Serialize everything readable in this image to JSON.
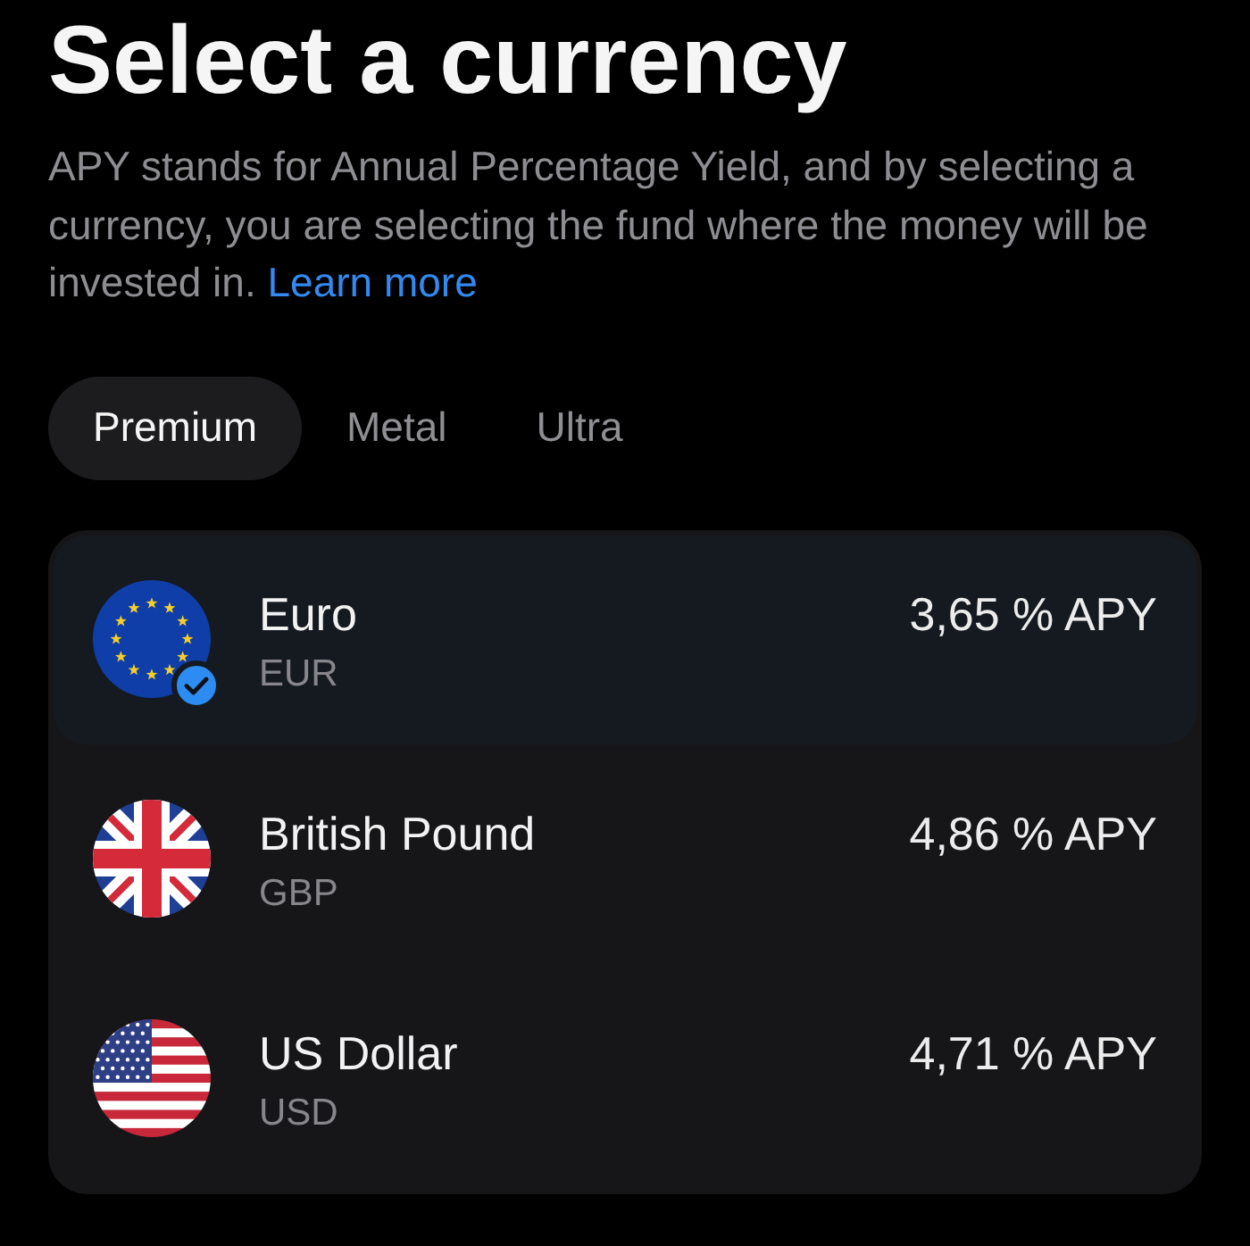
{
  "title": "Select a currency",
  "description": {
    "text": "APY stands for Annual Percentage Yield, and by selecting a currency, you are selecting the fund where the money will be invested in.",
    "link": "Learn more"
  },
  "tabs": [
    {
      "label": "Premium",
      "selected": true
    },
    {
      "label": "Metal",
      "selected": false
    },
    {
      "label": "Ultra",
      "selected": false
    }
  ],
  "currencies": [
    {
      "kind": "eu",
      "name": "Euro",
      "code": "EUR",
      "apy": "3,65 % APY",
      "selected": true
    },
    {
      "kind": "gb",
      "name": "British Pound",
      "code": "GBP",
      "apy": "4,86 % APY",
      "selected": false
    },
    {
      "kind": "us",
      "name": "US Dollar",
      "code": "USD",
      "apy": "4,71 % APY",
      "selected": false
    }
  ]
}
